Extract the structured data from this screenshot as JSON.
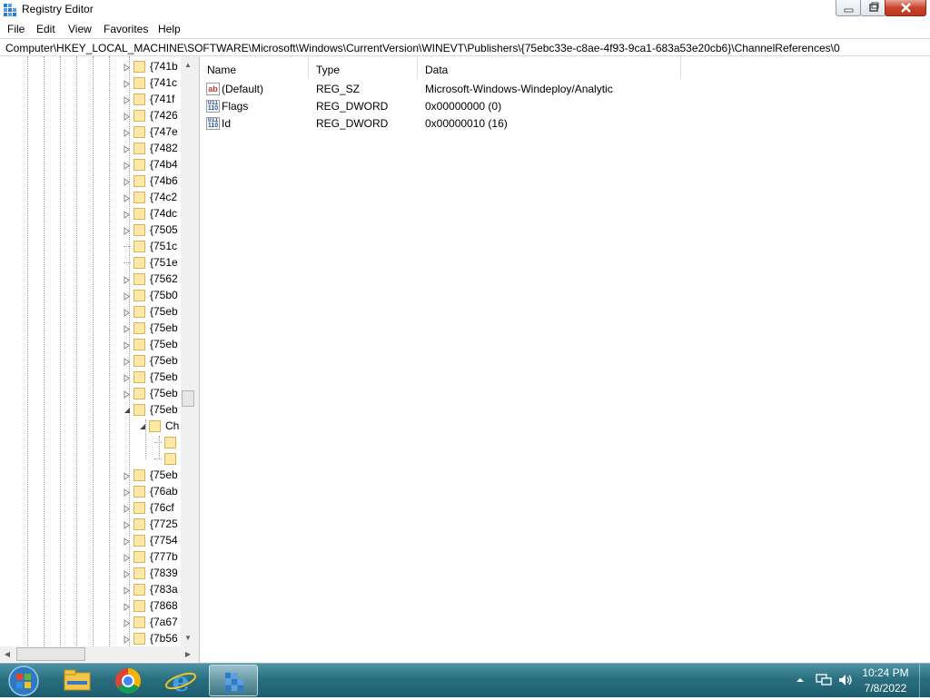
{
  "window": {
    "title": "Registry Editor"
  },
  "menu": {
    "file": "File",
    "edit": "Edit",
    "view": "View",
    "favorites": "Favorites",
    "help": "Help"
  },
  "address": {
    "path": "Computer\\HKEY_LOCAL_MACHINE\\SOFTWARE\\Microsoft\\Windows\\CurrentVersion\\WINEVT\\Publishers\\{75ebc33e-c8ae-4f93-9ca1-683a53e20cb6}\\ChannelReferences\\0"
  },
  "tree": {
    "items": [
      "{741b",
      "{741c",
      "{741f",
      "{7426",
      "{747e",
      "{7482",
      "{74b4",
      "{74b6",
      "{74c2",
      "{74dc",
      "{7505",
      "{751c",
      "{751e",
      "{7562",
      "{75b0",
      "{75eb",
      "{75eb",
      "{75eb",
      "{75eb",
      "{75eb",
      "{75eb",
      "{75eb"
    ],
    "child_label": "Ch",
    "items_after": [
      "{75eb",
      "{76ab",
      "{76cf",
      "{7725",
      "{7754",
      "{777b",
      "{7839",
      "{783a",
      "{7868",
      "{7a67",
      "{7b56"
    ]
  },
  "list": {
    "columns": {
      "name": "Name",
      "type": "Type",
      "data": "Data"
    },
    "rows": [
      {
        "name": "(Default)",
        "type": "REG_SZ",
        "data": "Microsoft-Windows-Windeploy/Analytic",
        "icon": "string-value-icon"
      },
      {
        "name": "Flags",
        "type": "REG_DWORD",
        "data": "0x00000000 (0)",
        "icon": "binary-value-icon"
      },
      {
        "name": "Id",
        "type": "REG_DWORD",
        "data": "0x00000010 (16)",
        "icon": "binary-value-icon"
      }
    ]
  },
  "taskbar": {
    "pinned": [
      "file-explorer-icon",
      "chrome-icon",
      "internet-explorer-icon",
      "regedit-icon"
    ],
    "clock": {
      "time": "10:24 PM",
      "date": "7/8/2022"
    }
  },
  "colors": {
    "taskbar": "#2a6f80",
    "folder": "#fde9a6"
  }
}
